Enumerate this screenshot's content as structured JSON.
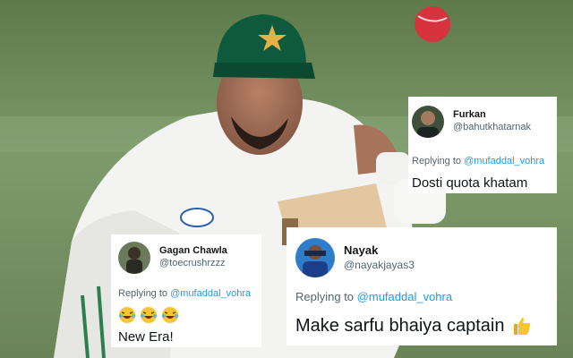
{
  "tweets": [
    {
      "name": "Furkan",
      "handle": "@bahutkhatarnak",
      "reply_prefix": "Replying to",
      "mention": "@mufaddal_vohra",
      "text": "Dosti quota khatam"
    },
    {
      "name": "Gagan Chawla",
      "handle": "@toecrushrzzz",
      "reply_prefix": "Replying to",
      "mention": "@mufaddal_vohra",
      "emoji": "😂😂😂",
      "text": "New Era!"
    },
    {
      "name": "Nayak",
      "handle": "@nayakjayas3",
      "reply_prefix": "Replying to",
      "mention": "@mufaddal_vohra",
      "text": "Make sarfu bhaiya captain",
      "emoji": "👍"
    }
  ],
  "colors": {
    "mention": "#1d9bf0",
    "handle": "#536471",
    "cap": "#0f5a3c",
    "jersey": "#f4f4f2",
    "ball": "#d8323f"
  }
}
